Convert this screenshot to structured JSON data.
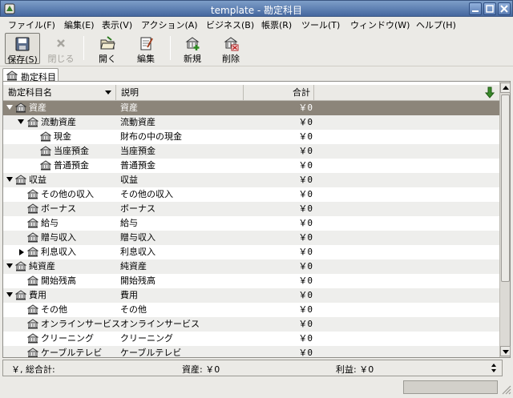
{
  "window": {
    "title": "template - 勘定科目"
  },
  "menu": [
    "ファイル(F)",
    "編集(E)",
    "表示(V)",
    "アクション(A)",
    "ビジネス(B)",
    "帳票(R)",
    "ツール(T)",
    "ウィンドウ(W)",
    "ヘルプ(H)"
  ],
  "toolbar": {
    "save": "保存(S)",
    "close": "閉じる",
    "open": "開く",
    "edit": "編集",
    "new": "新規",
    "delete": "削除"
  },
  "tab": {
    "label": "勘定科目"
  },
  "columns": {
    "name": "勘定科目名",
    "description": "説明",
    "total": "合計"
  },
  "rows": [
    {
      "name": "資産",
      "description": "資産",
      "total": "￥0"
    },
    {
      "name": "流動資産",
      "description": "流動資産",
      "total": "￥0"
    },
    {
      "name": "現金",
      "description": "財布の中の現金",
      "total": "￥0"
    },
    {
      "name": "当座預金",
      "description": "当座預金",
      "total": "￥0"
    },
    {
      "name": "普通預金",
      "description": "普通預金",
      "total": "￥0"
    },
    {
      "name": "収益",
      "description": "収益",
      "total": "￥0"
    },
    {
      "name": "その他の収入",
      "description": "その他の収入",
      "total": "￥0"
    },
    {
      "name": "ボーナス",
      "description": "ボーナス",
      "total": "￥0"
    },
    {
      "name": "給与",
      "description": "給与",
      "total": "￥0"
    },
    {
      "name": "贈与収入",
      "description": "贈与収入",
      "total": "￥0"
    },
    {
      "name": "利息収入",
      "description": "利息収入",
      "total": "￥0"
    },
    {
      "name": "純資産",
      "description": "純資産",
      "total": "￥0"
    },
    {
      "name": "開始残高",
      "description": "開始残高",
      "total": "￥0"
    },
    {
      "name": "費用",
      "description": "費用",
      "total": "￥0"
    },
    {
      "name": "その他",
      "description": "その他",
      "total": "￥0"
    },
    {
      "name": "オンラインサービス",
      "description": "オンラインサービス",
      "total": "￥0"
    },
    {
      "name": "クリーニング",
      "description": "クリーニング",
      "total": "￥0"
    },
    {
      "name": "ケーブルテレビ",
      "description": "ケーブルテレビ",
      "total": "￥0"
    }
  ],
  "summary": {
    "currency": "￥, 総合計:",
    "assets": "資産: ￥0",
    "profit": "利益: ￥0"
  },
  "colors": {
    "titlebar": "#45679f",
    "selected_row": "#8c857a",
    "background": "#ebeae6"
  }
}
